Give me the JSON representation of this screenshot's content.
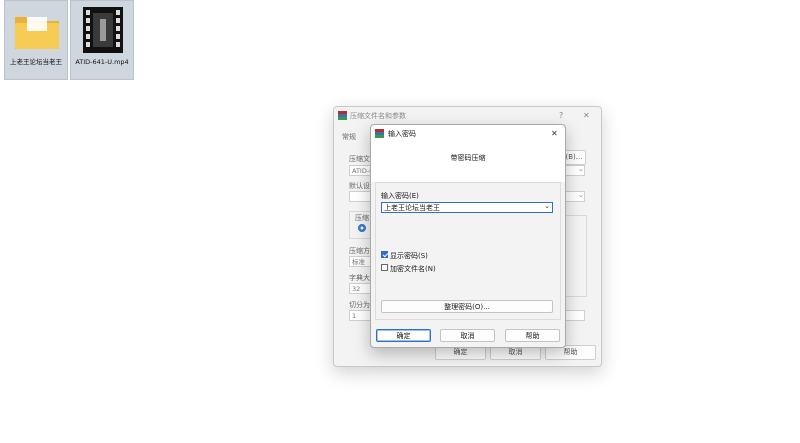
{
  "desktop": {
    "icons": [
      {
        "label": "上老王论坛当老王",
        "icon": "folder-icon"
      },
      {
        "label": "ATID-641-U.mp4",
        "icon": "video-file-icon"
      }
    ]
  },
  "background_dialog": {
    "title": "压缩文件名和参数",
    "help_symbol": "?",
    "close_symbol": "✕",
    "tab": "常规",
    "label_archive_name": "压缩文",
    "archive_name_value": "ATID-6",
    "browse_button": "(B)...",
    "label_default": "默认设",
    "label_format": "压缩",
    "label_method": "压缩方",
    "method_value": "标准",
    "label_dict": "字典大",
    "dict_value": "32",
    "label_split": "切分为",
    "split_value": "1",
    "ok_button": "确定",
    "cancel_button": "取消",
    "help_button": "帮助"
  },
  "dialog": {
    "title": "输入密码",
    "close_symbol": "✕",
    "header": "带密码压缩",
    "password_label": "输入密码(E)",
    "password_value": "上老王论坛当老王",
    "show_password_label": "显示密码(S)",
    "show_password_checked": true,
    "encrypt_names_label": "加密文件名(N)",
    "encrypt_names_checked": false,
    "organize_button": "整理密码(O)...",
    "ok_button": "确定",
    "cancel_button": "取消",
    "help_button": "帮助"
  },
  "colors": {
    "accent": "#2f6fca",
    "folder": "#f5c542"
  }
}
